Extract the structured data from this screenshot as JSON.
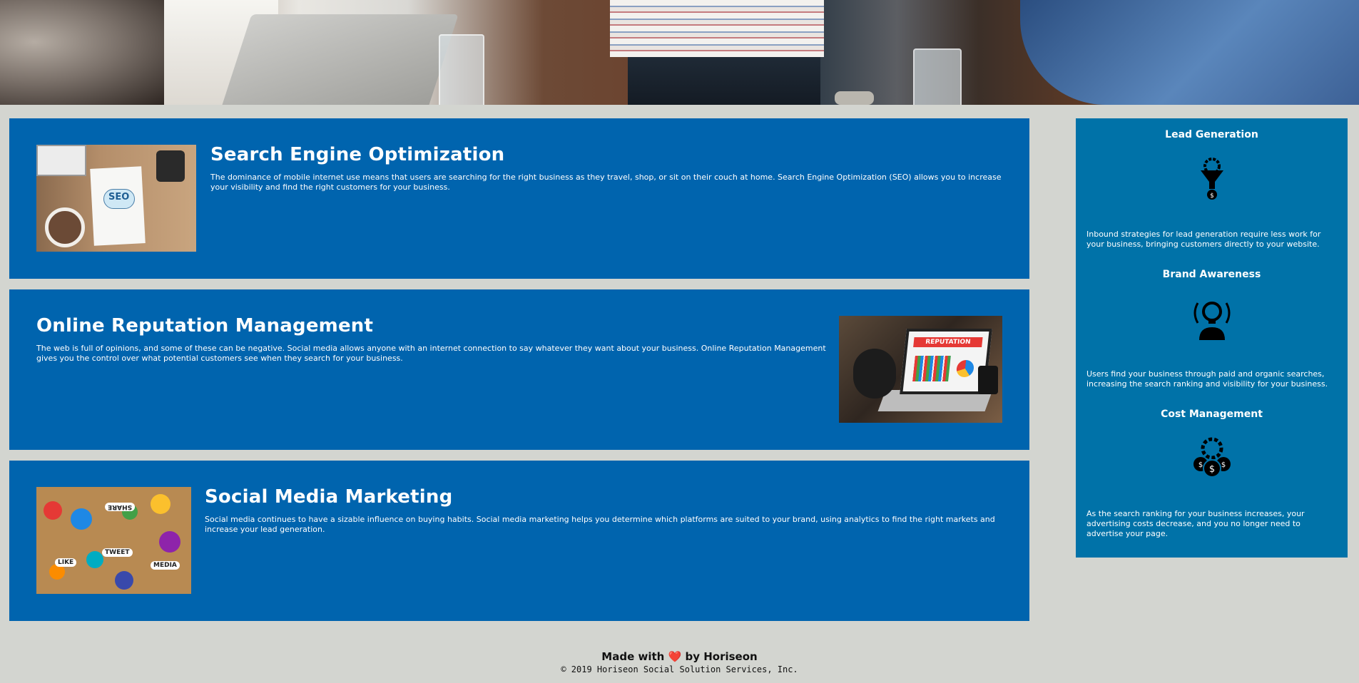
{
  "hero": {
    "image_name": "hero-team-meeting-image"
  },
  "cards": [
    {
      "title": "Search Engine Optimization",
      "body": "The dominance of mobile internet use means that users are searching for the right business as they travel, shop, or sit on their couch at home. Search Engine Optimization (SEO) allows you to increase your visibility and find the right customers for your business.",
      "image_name": "seo-illustration-image",
      "image_text": "SEO"
    },
    {
      "title": "Online Reputation Management",
      "body": "The web is full of opinions, and some of these can be negative. Social media allows anyone with an internet connection to say whatever they want about your business. Online Reputation Management gives you the control over what potential customers see when they search for your business.",
      "image_name": "reputation-laptop-image",
      "image_text": "REPUTATION"
    },
    {
      "title": "Social Media Marketing",
      "body": "Social media continues to have a sizable influence on buying habits. Social media marketing helps you determine which platforms are suited to your brand, using analytics to find the right markets and increase your lead generation.",
      "image_name": "social-media-image",
      "image_labels": [
        "TWEET",
        "LIKE",
        "MEDIA",
        "SHARE"
      ]
    }
  ],
  "sidebar": [
    {
      "title": "Lead Generation",
      "icon": "lead-funnel-icon",
      "body": "Inbound strategies for lead generation require less work for your business, bringing customers directly to your website."
    },
    {
      "title": "Brand Awareness",
      "icon": "brand-lightbulb-icon",
      "body": "Users find your business through paid and organic searches, increasing the search ranking and visibility for your business."
    },
    {
      "title": "Cost Management",
      "icon": "cost-coins-icon",
      "body": "As the search ranking for your business increases, your advertising costs decrease, and you no longer need to advertise your page."
    }
  ],
  "footer": {
    "made_prefix": "Made with",
    "heart": "❤️",
    "made_suffix": "by Horiseon",
    "copyright": "© 2019 Horiseon Social Solution Services, Inc."
  },
  "colors": {
    "page_bg": "#d3d5d0",
    "card_bg": "#0064ae",
    "sidebar_bg": "#0072a8",
    "text": "#ffffff"
  }
}
